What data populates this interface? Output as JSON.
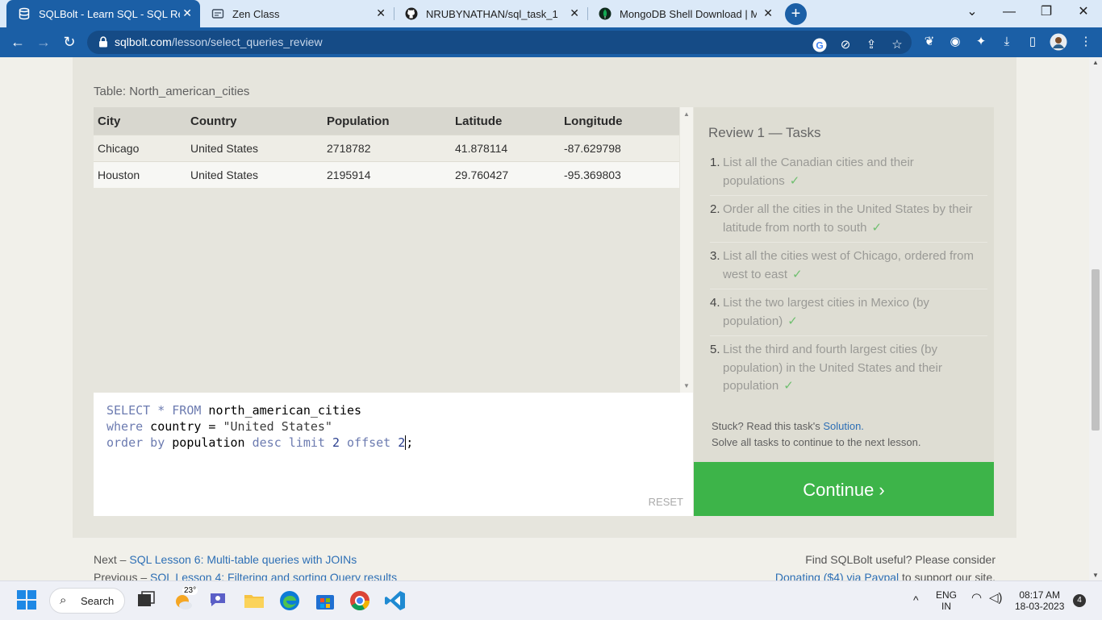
{
  "browser": {
    "tabs": [
      {
        "title": "SQLBolt - Learn SQL - SQL Review",
        "active": true
      },
      {
        "title": "Zen Class",
        "active": false
      },
      {
        "title": "NRUBYNATHAN/sql_task_1",
        "active": false
      },
      {
        "title": "MongoDB Shell Download | MongoDB",
        "active": false
      }
    ],
    "url_host": "sqlbolt.com",
    "url_path": "/lesson/select_queries_review",
    "colors": {
      "frame": "#dbe9f8",
      "toolbar": "#1b5fa6"
    }
  },
  "lesson": {
    "table_label": "Table: North_american_cities",
    "columns": [
      "City",
      "Country",
      "Population",
      "Latitude",
      "Longitude"
    ],
    "rows": [
      [
        "Chicago",
        "United States",
        "2718782",
        "41.878114",
        "-87.629798"
      ],
      [
        "Houston",
        "United States",
        "2195914",
        "29.760427",
        "-95.369803"
      ]
    ],
    "reset_label": "RESET",
    "tasks_title": "Review 1 — Tasks",
    "tasks": [
      {
        "num": "1.",
        "text": "List all the Canadian cities and their populations",
        "check": "✓"
      },
      {
        "num": "2.",
        "text": "Order all the cities in the United States by their latitude from north to south",
        "check": "✓"
      },
      {
        "num": "3.",
        "text": "List all the cities west of Chicago, ordered from west to east",
        "check": "✓"
      },
      {
        "num": "4.",
        "text": "List the two largest cities in Mexico (by population)",
        "check": "✓"
      },
      {
        "num": "5.",
        "text": "List the third and fourth largest cities (by population) in the United States and their population",
        "check": "✓"
      }
    ],
    "stuck_text": "Stuck? Read this task's ",
    "solution_link": "Solution.",
    "solve_all_text": "Solve all tasks to continue to the next lesson.",
    "continue_label": "Continue ›",
    "continue_color": "#3db449"
  },
  "editor": {
    "line1_kw1": "SELECT * FROM",
    "line1_rest": " north_american_cities",
    "line2_kw": "where",
    "line2_mid": " country = ",
    "line2_str": "\"United States\"",
    "line3_kw1": "order by",
    "line3_mid": " population ",
    "line3_kw2": "desc limit",
    "line3_num1": " 2 ",
    "line3_kw3": "offset",
    "line3_num2": " 2",
    "line3_end": ";"
  },
  "footer": {
    "next_prefix": "Next – ",
    "next_link": "SQL Lesson 6: Multi-table queries with JOINs",
    "prev_prefix": "Previous – ",
    "prev_link": "SQL Lesson 4: Filtering and sorting Query results",
    "useful_text": "Find SQLBolt useful? Please consider",
    "donate_link": "Donating ($4) via Paypal",
    "donate_suffix": " to support our site."
  },
  "taskbar": {
    "search_label": "Search",
    "weather_temp": "23°",
    "lang_top": "ENG",
    "lang_bottom": "IN",
    "time": "08:17 AM",
    "date": "18-03-2023",
    "notifications": "4"
  }
}
